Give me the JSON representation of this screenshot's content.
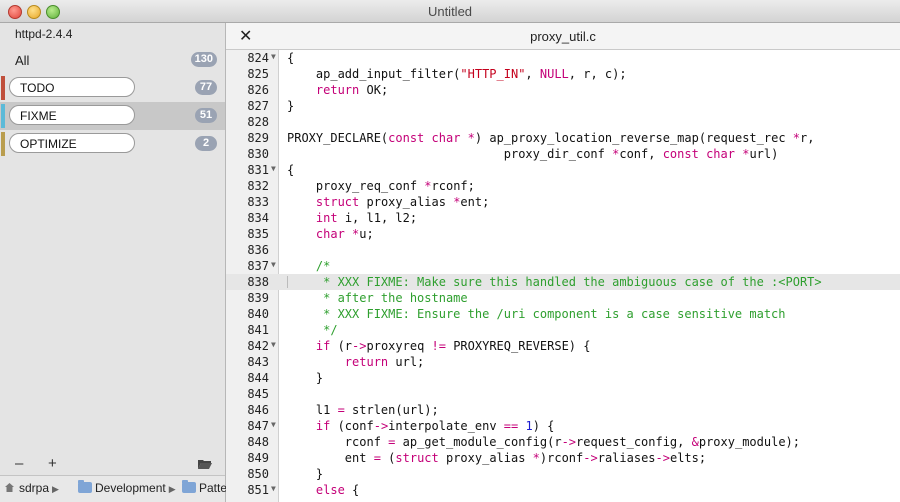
{
  "window": {
    "title": "Untitled"
  },
  "sidebar": {
    "project": "httpd-2.4.4",
    "all": {
      "label": "All",
      "count": "130"
    },
    "categories": [
      {
        "label": "TODO",
        "count": "77",
        "color": "#c0503c"
      },
      {
        "label": "FIXME",
        "count": "51",
        "color": "#5bbad8"
      },
      {
        "label": "OPTIMIZE",
        "count": "2",
        "color": "#b99d4e"
      }
    ],
    "selected": "FIXME",
    "buttons": {
      "remove": "–",
      "add": "+"
    },
    "path": [
      "sdrpa",
      "Development",
      "Patte"
    ]
  },
  "editor": {
    "tab_title": "proxy_util.c",
    "highlighted_line": 838,
    "lines": [
      {
        "n": 824,
        "fold": true,
        "code": "{"
      },
      {
        "n": 825,
        "code": "    ap_add_input_filter(\"HTTP_IN\", NULL, r, c);"
      },
      {
        "n": 826,
        "code": "    return OK;"
      },
      {
        "n": 827,
        "code": "}"
      },
      {
        "n": 828,
        "code": ""
      },
      {
        "n": 829,
        "code": "PROXY_DECLARE(const char *) ap_proxy_location_reverse_map(request_rec *r,"
      },
      {
        "n": 830,
        "code": "                              proxy_dir_conf *conf, const char *url)"
      },
      {
        "n": 831,
        "fold": true,
        "code": "{"
      },
      {
        "n": 832,
        "code": "    proxy_req_conf *rconf;"
      },
      {
        "n": 833,
        "code": "    struct proxy_alias *ent;"
      },
      {
        "n": 834,
        "code": "    int i, l1, l2;"
      },
      {
        "n": 835,
        "code": "    char *u;"
      },
      {
        "n": 836,
        "code": ""
      },
      {
        "n": 837,
        "fold": true,
        "code": "    /*"
      },
      {
        "n": 838,
        "code": "     * XXX FIXME: Make sure this handled the ambiguous case of the :<PORT>"
      },
      {
        "n": 839,
        "code": "     * after the hostname"
      },
      {
        "n": 840,
        "code": "     * XXX FIXME: Ensure the /uri component is a case sensitive match"
      },
      {
        "n": 841,
        "code": "     */"
      },
      {
        "n": 842,
        "fold": true,
        "code": "    if (r->proxyreq != PROXYREQ_REVERSE) {"
      },
      {
        "n": 843,
        "code": "        return url;"
      },
      {
        "n": 844,
        "code": "    }"
      },
      {
        "n": 845,
        "code": ""
      },
      {
        "n": 846,
        "code": "    l1 = strlen(url);"
      },
      {
        "n": 847,
        "fold": true,
        "code": "    if (conf->interpolate_env == 1) {"
      },
      {
        "n": 848,
        "code": "        rconf = ap_get_module_config(r->request_config, &proxy_module);"
      },
      {
        "n": 849,
        "code": "        ent = (struct proxy_alias *)rconf->raliases->elts;"
      },
      {
        "n": 850,
        "code": "    }"
      },
      {
        "n": 851,
        "fold": true,
        "code": "    else {"
      }
    ]
  }
}
